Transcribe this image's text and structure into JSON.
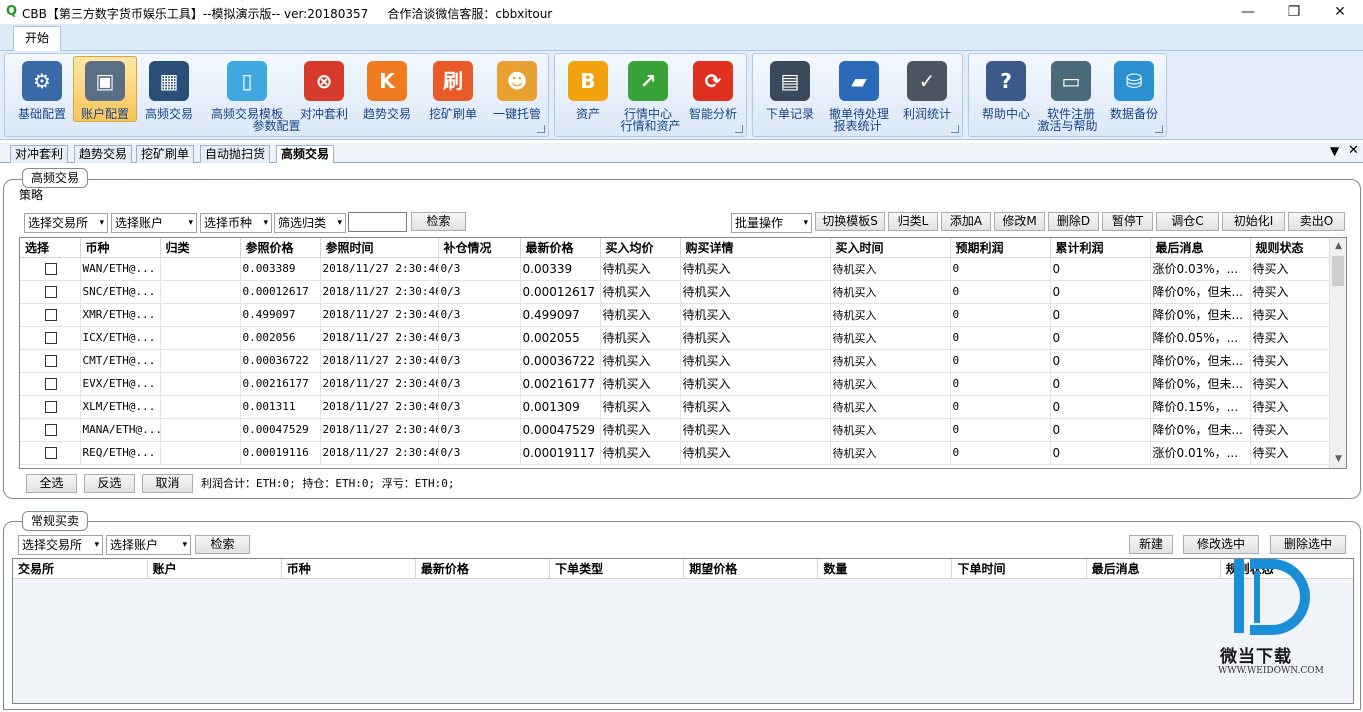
{
  "window": {
    "app_icon": "Q",
    "title": "CBB【第三方数字货币娱乐工具】--模拟演示版-- ver:20180357     合作洽谈微信客服：cbbxitour",
    "min": "—",
    "max": "❐",
    "close": "✕"
  },
  "ribbon": {
    "tab": "开始",
    "groups": [
      {
        "label": "参数配置",
        "buttons": [
          {
            "label": "基础配置",
            "icon": "toolbox-icon",
            "color": "#3a6aa8",
            "glyph": "⚙"
          },
          {
            "label": "账户配置",
            "icon": "computer-icon",
            "color": "#5a6f86",
            "glyph": "▣",
            "active": true
          },
          {
            "label": "高频交易",
            "icon": "server-icon",
            "color": "#2a4f78",
            "glyph": "▦"
          },
          {
            "label": "高频交易模板",
            "icon": "phone-icon",
            "color": "#3fa8e0",
            "glyph": "▯"
          },
          {
            "label": "对冲套利",
            "icon": "hedge-icon",
            "color": "#d63a2a",
            "glyph": "⊗"
          },
          {
            "label": "趋势交易",
            "icon": "trend-icon",
            "color": "#f07b20",
            "glyph": "K"
          },
          {
            "label": "挖矿刷单",
            "icon": "mining-icon",
            "color": "#e85a2a",
            "glyph": "刷"
          },
          {
            "label": "一键托管",
            "icon": "robot-icon",
            "color": "#e8a030",
            "glyph": "☻"
          }
        ]
      },
      {
        "label": "行情和资产",
        "buttons": [
          {
            "label": "资产",
            "icon": "bitcoin-icon",
            "color": "#f2a20c",
            "glyph": "B"
          },
          {
            "label": "行情中心",
            "icon": "chart-up-icon",
            "color": "#39a33a",
            "glyph": "↗"
          },
          {
            "label": "智能分析",
            "icon": "refresh-icon",
            "color": "#e03020",
            "glyph": "⟳"
          }
        ]
      },
      {
        "label": "报表统计",
        "buttons": [
          {
            "label": "下单记录",
            "icon": "order-record-icon",
            "color": "#3a4a5a",
            "glyph": "▤"
          },
          {
            "label": "撤单待处理",
            "icon": "folder-icon",
            "color": "#2a6ab8",
            "glyph": "▰"
          },
          {
            "label": "利润统计",
            "icon": "folder-check-icon",
            "color": "#4a5560",
            "glyph": "✓"
          }
        ]
      },
      {
        "label": "激活与帮助",
        "buttons": [
          {
            "label": "帮助中心",
            "icon": "help-icon",
            "color": "#3a5a8a",
            "glyph": "?"
          },
          {
            "label": "软件注册",
            "icon": "register-icon",
            "color": "#4a6a7a",
            "glyph": "▭"
          },
          {
            "label": "数据备份",
            "icon": "backup-icon",
            "color": "#2a90d0",
            "glyph": "⛁"
          }
        ]
      }
    ]
  },
  "doc_tabs": [
    "对冲套利",
    "趋势交易",
    "挖矿刷单",
    "自动抛扫货",
    "高频交易"
  ],
  "hft": {
    "panel_title": "高频交易",
    "sub_label": "策略",
    "filters": [
      "选择交易所",
      "选择账户",
      "选择币种",
      "筛选归类"
    ],
    "search_value": "",
    "search_btn": "检索",
    "batch": "批量操作",
    "actions": [
      "切换模板S",
      "归类L",
      "添加A",
      "修改M",
      "删除D",
      "暂停T",
      "调仓C",
      "初始化I",
      "卖出O"
    ],
    "columns": [
      "选择",
      "币种",
      "归类",
      "参照价格",
      "参照时间",
      "补仓情况",
      "最新价格",
      "买入均价",
      "购买详情",
      "买入时间",
      "预期利润",
      "累计利润",
      "最后消息",
      "规则状态"
    ],
    "rows": [
      [
        "WAN/ETH@...",
        "",
        "0.003389",
        "2018/11/27 2:30:46",
        "0/3",
        "0.00339",
        "待机买入",
        "待机买入",
        "待机买入",
        "0",
        "0",
        "涨价0.03%，...",
        "待买入"
      ],
      [
        "SNC/ETH@...",
        "",
        "0.00012617",
        "2018/11/27 2:30:46",
        "0/3",
        "0.00012617",
        "待机买入",
        "待机买入",
        "待机买入",
        "0",
        "0",
        "降价0%，但未...",
        "待买入"
      ],
      [
        "XMR/ETH@...",
        "",
        "0.499097",
        "2018/11/27 2:30:46",
        "0/3",
        "0.499097",
        "待机买入",
        "待机买入",
        "待机买入",
        "0",
        "0",
        "降价0%，但未...",
        "待买入"
      ],
      [
        "ICX/ETH@...",
        "",
        "0.002056",
        "2018/11/27 2:30:46",
        "0/3",
        "0.002055",
        "待机买入",
        "待机买入",
        "待机买入",
        "0",
        "0",
        "降价0.05%，...",
        "待买入"
      ],
      [
        "CMT/ETH@...",
        "",
        "0.00036722",
        "2018/11/27 2:30:46",
        "0/3",
        "0.00036722",
        "待机买入",
        "待机买入",
        "待机买入",
        "0",
        "0",
        "降价0%，但未...",
        "待买入"
      ],
      [
        "EVX/ETH@...",
        "",
        "0.00216177",
        "2018/11/27 2:30:46",
        "0/3",
        "0.00216177",
        "待机买入",
        "待机买入",
        "待机买入",
        "0",
        "0",
        "降价0%，但未...",
        "待买入"
      ],
      [
        "XLM/ETH@...",
        "",
        "0.001311",
        "2018/11/27 2:30:46",
        "0/3",
        "0.001309",
        "待机买入",
        "待机买入",
        "待机买入",
        "0",
        "0",
        "降价0.15%，...",
        "待买入"
      ],
      [
        "MANA/ETH@...",
        "",
        "0.00047529",
        "2018/11/27 2:30:46",
        "0/3",
        "0.00047529",
        "待机买入",
        "待机买入",
        "待机买入",
        "0",
        "0",
        "降价0%，但未...",
        "待买入"
      ],
      [
        "REQ/ETH@...",
        "",
        "0.00019116",
        "2018/11/27 2:30:46",
        "0/3",
        "0.00019117",
        "待机买入",
        "待机买入",
        "待机买入",
        "0",
        "0",
        "涨价0.01%，...",
        "待买入"
      ]
    ],
    "bottom_btns": [
      "全选",
      "反选",
      "取消"
    ],
    "summary": "利润合计：ETH:0;  持仓：ETH:0;  浮亏：ETH:0;"
  },
  "regular": {
    "panel_title": "常规买卖",
    "filters": [
      "选择交易所",
      "选择账户"
    ],
    "search_btn": "检索",
    "actions": [
      "新建",
      "修改选中",
      "删除选中"
    ],
    "columns": [
      "交易所",
      "账户",
      "币种",
      "最新价格",
      "下单类型",
      "期望价格",
      "数量",
      "下单时间",
      "最后消息",
      "规则状态"
    ]
  },
  "watermark": {
    "brand": "微当下载",
    "url": "WWW.WEIDOWN.COM",
    "color": "#1a8fd8"
  }
}
